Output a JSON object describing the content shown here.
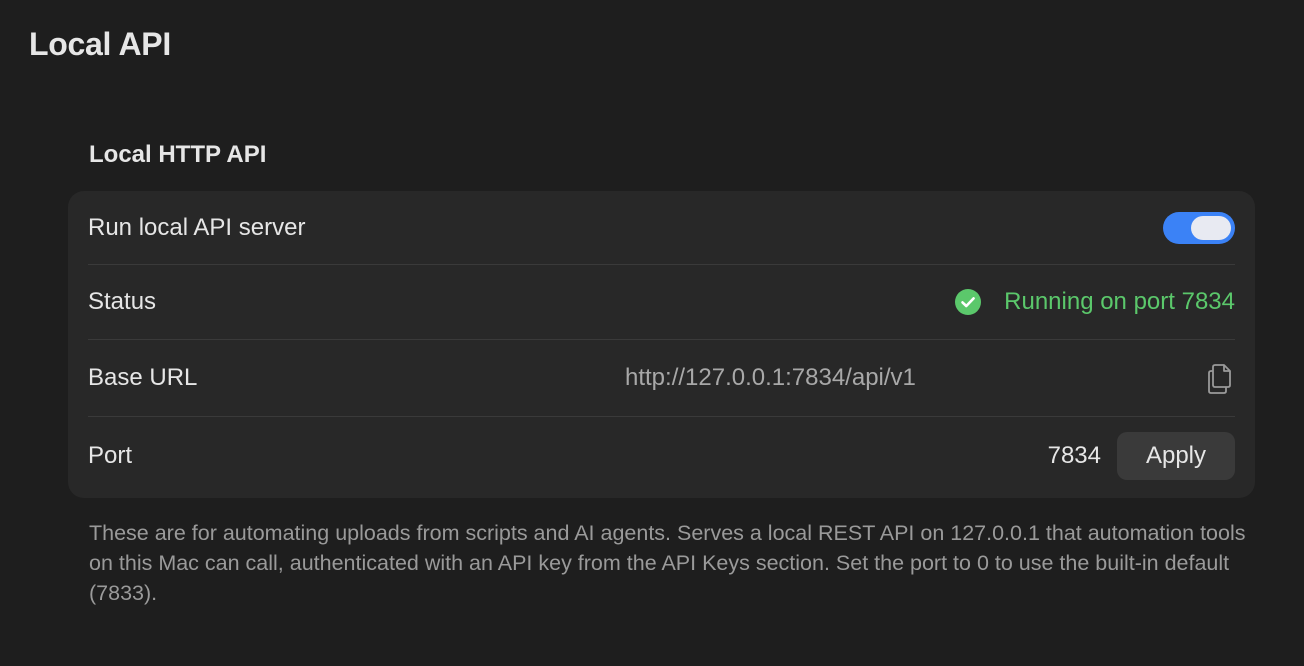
{
  "page": {
    "title": "Local API"
  },
  "section": {
    "title": "Local HTTP API"
  },
  "rows": {
    "run_server": {
      "label": "Run local API server",
      "enabled": true
    },
    "status": {
      "label": "Status",
      "value": "Running on port 7834",
      "icon": "checkmark-circle-icon"
    },
    "base_url": {
      "label": "Base URL",
      "value": "http://127.0.0.1:7834/api/v1",
      "icon": "copy-icon"
    },
    "port": {
      "label": "Port",
      "value": "7834",
      "button_label": "Apply"
    }
  },
  "footnote": "These are for automating uploads from scripts and AI agents. Serves a local REST API on 127.0.0.1 that automation tools on this Mac can call, authenticated with an API key from the API Keys section. Set the port to 0 to use the built-in default (7833).",
  "colors": {
    "background": "#1e1e1e",
    "card": "#282828",
    "accent": "#3b82f6",
    "status_ok": "#5bc86b",
    "muted_text": "#9a9a9a"
  }
}
